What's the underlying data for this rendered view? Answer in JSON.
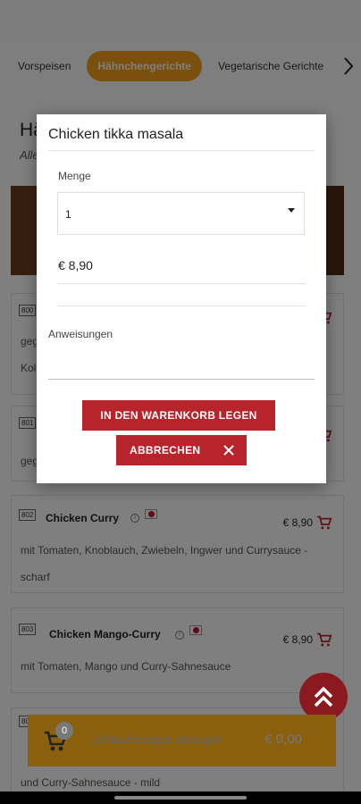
{
  "categories": {
    "tabs": [
      {
        "label": "Vorspeisen",
        "active": false
      },
      {
        "label": "Hähnchengerichte",
        "active": true
      },
      {
        "label": "Vegetarische Gerichte",
        "active": false
      }
    ],
    "next_icon": "chevron-right-icon"
  },
  "section": {
    "title": "Hä",
    "subtitle": "Alle"
  },
  "items": [
    {
      "number": "800",
      "name": "",
      "price": "",
      "description": [
        "geg",
        "Kol"
      ]
    },
    {
      "number": "801",
      "name": "",
      "price": "",
      "description": [
        "geg"
      ]
    },
    {
      "number": "802",
      "name": "Chicken Curry",
      "price": "€ 8,90",
      "description": [
        "mit Tomaten, Knoblauch, Zwiebeln, Ingwer und Currysauce -",
        "scharf"
      ]
    },
    {
      "number": "803",
      "name": "Chicken Mango-Curry",
      "price": "€ 8,90",
      "description": [
        "mit Tomaten, Mango und Curry-Sahnesauce"
      ]
    },
    {
      "number": "80",
      "name": "",
      "price": "",
      "description": [
        "und Curry-Sahnesauce - mild"
      ]
    }
  ],
  "dialog": {
    "title": "Chicken tikka masala",
    "quantity_label": "Menge",
    "quantity_value": "1",
    "price": "€ 8,90",
    "instructions_label": "Anweisungen",
    "add_button": "IN DEN WARENKORB LEGEN",
    "cancel_button": "ABBRECHEN"
  },
  "cart": {
    "count": "0",
    "label": "Einkaufswagen anzeigen",
    "total": "€ 0,00"
  },
  "colors": {
    "accent_orange": "#f6a01a",
    "brand_red": "#b8242c",
    "fab_red": "#8a1a1f"
  }
}
